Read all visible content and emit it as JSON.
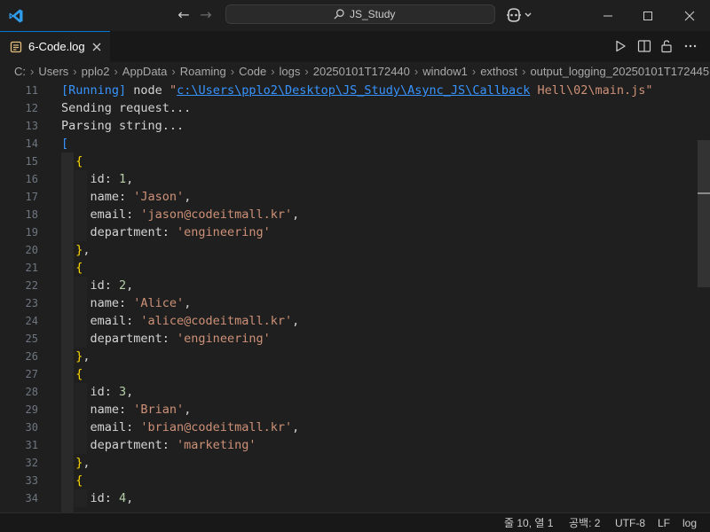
{
  "titlebar": {
    "search_text": "JS_Study",
    "icons": [
      "vscode-logo-icon",
      "arrow-left-icon",
      "arrow-right-icon",
      "search-icon",
      "copilot-icon",
      "chevron-down-icon",
      "minimize-icon",
      "maximize-icon",
      "close-icon"
    ]
  },
  "tab": {
    "label": "6-Code.log"
  },
  "breadcrumb": {
    "items": [
      "C:",
      "Users",
      "pplo2",
      "AppData",
      "Roaming",
      "Code",
      "logs",
      "20250101T172440",
      "window1",
      "exthost",
      "output_logging_20250101T172445"
    ]
  },
  "editor": {
    "lines": [
      {
        "n": "11",
        "t": "[Running] node \"c:\\Users\\pplo2\\Desktop\\JS_Study\\Async_JS\\Callback Hell\\02\\main.js\""
      },
      {
        "n": "12",
        "t": "Sending request..."
      },
      {
        "n": "13",
        "t": "Parsing string..."
      },
      {
        "n": "14",
        "t": "["
      },
      {
        "n": "15",
        "t": "  {"
      },
      {
        "n": "16",
        "t": "    id: 1,"
      },
      {
        "n": "17",
        "t": "    name: 'Jason',"
      },
      {
        "n": "18",
        "t": "    email: 'jason@codeitmall.kr',"
      },
      {
        "n": "19",
        "t": "    department: 'engineering'"
      },
      {
        "n": "20",
        "t": "  },"
      },
      {
        "n": "21",
        "t": "  {"
      },
      {
        "n": "22",
        "t": "    id: 2,"
      },
      {
        "n": "23",
        "t": "    name: 'Alice',"
      },
      {
        "n": "24",
        "t": "    email: 'alice@codeitmall.kr',"
      },
      {
        "n": "25",
        "t": "    department: 'engineering'"
      },
      {
        "n": "26",
        "t": "  },"
      },
      {
        "n": "27",
        "t": "  {"
      },
      {
        "n": "28",
        "t": "    id: 3,"
      },
      {
        "n": "29",
        "t": "    name: 'Brian',"
      },
      {
        "n": "30",
        "t": "    email: 'brian@codeitmall.kr',"
      },
      {
        "n": "31",
        "t": "    department: 'marketing'"
      },
      {
        "n": "32",
        "t": "  },"
      },
      {
        "n": "33",
        "t": "  {"
      },
      {
        "n": "34",
        "t": "    id: 4,"
      }
    ]
  },
  "statusbar": {
    "position": "줄 10, 열 1",
    "spaces": "공백: 2",
    "encoding": "UTF-8",
    "eol": "LF",
    "language": "log"
  },
  "colors": {
    "accent": "#0078d4",
    "string": "#ce9178",
    "number": "#b5cea8",
    "link": "#3794ff",
    "bracket_level1": "#ffd700",
    "bracket_level2": "#da70d6"
  }
}
